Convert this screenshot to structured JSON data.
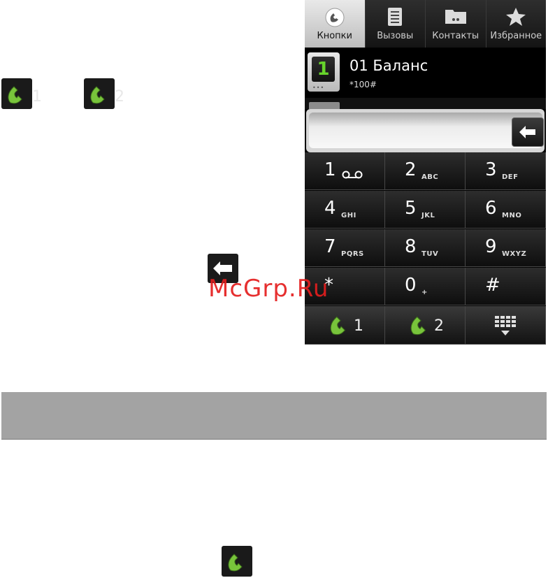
{
  "left_icons": {
    "sim1_label": "1",
    "sim2_label": "2"
  },
  "watermark": "McGrp.Ru",
  "dialer": {
    "tabs": [
      {
        "label": "Кнопки",
        "icon": "phone-icon",
        "active": true
      },
      {
        "label": "Вызовы",
        "icon": "call-log-icon",
        "active": false
      },
      {
        "label": "Контакты",
        "icon": "contacts-icon",
        "active": false
      },
      {
        "label": "Избранное",
        "icon": "star-icon",
        "active": false
      }
    ],
    "speed_dial": {
      "sim_badge": "1",
      "name": "01 Баланс",
      "number": "*100#"
    },
    "input": {
      "value": ""
    },
    "keys": [
      {
        "digit": "1",
        "letters": ""
      },
      {
        "digit": "2",
        "letters": "ABC"
      },
      {
        "digit": "3",
        "letters": "DEF"
      },
      {
        "digit": "4",
        "letters": "GHI"
      },
      {
        "digit": "5",
        "letters": "JKL"
      },
      {
        "digit": "6",
        "letters": "MNO"
      },
      {
        "digit": "7",
        "letters": "PQRS"
      },
      {
        "digit": "8",
        "letters": "TUV"
      },
      {
        "digit": "9",
        "letters": "WXYZ"
      },
      {
        "digit": "*",
        "letters": ""
      },
      {
        "digit": "0",
        "letters": "+"
      },
      {
        "digit": "#",
        "letters": ""
      }
    ],
    "call_buttons": {
      "sim1": "1",
      "sim2": "2"
    }
  },
  "colors": {
    "phone_green": "#78c43b",
    "accent_badge": "#67d42b",
    "gray_bar": "#a3a3a3"
  }
}
